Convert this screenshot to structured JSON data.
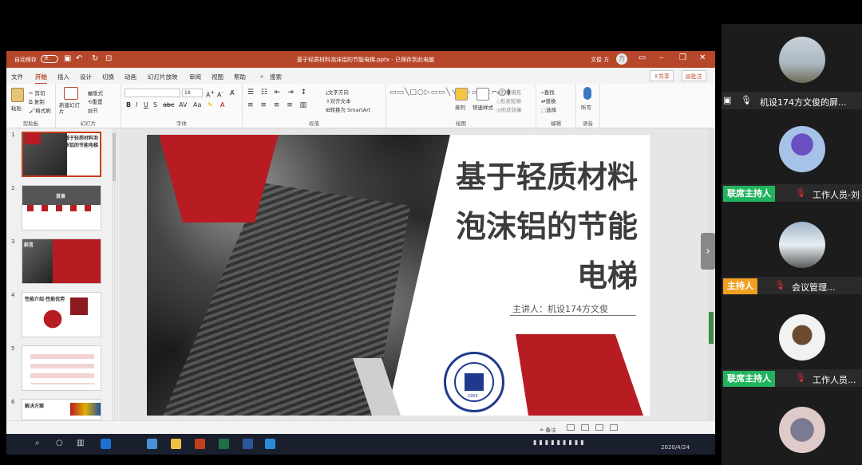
{
  "titlebar": {
    "autosave": "自动保存",
    "autosave_state": "关",
    "doc_title": "基于轻质材料泡沫铝的节能电梯.pptx - 已保存到此电脑",
    "user": "文俊 方",
    "user_initial": "方"
  },
  "tabs": [
    "文件",
    "开始",
    "插入",
    "设计",
    "切换",
    "动画",
    "幻灯片放映",
    "审阅",
    "视图",
    "帮助"
  ],
  "search_label": "搜索",
  "share_label": "共享",
  "comment_label": "批注",
  "ribbon": {
    "clipboard": {
      "label": "剪贴板",
      "paste": "粘贴",
      "cut": "剪切",
      "copy": "复制",
      "format_painter": "格式刷"
    },
    "slides": {
      "label": "幻灯片",
      "new_slide": "新建幻灯片",
      "layout": "版式",
      "reset": "重置",
      "section": "节"
    },
    "font": {
      "label": "字体",
      "size": "18"
    },
    "paragraph": {
      "label": "段落",
      "text_direction": "文字方向",
      "align_text": "对齐文本",
      "smartart": "转换为 SmartArt"
    },
    "drawing": {
      "label": "绘图",
      "arrange": "排列",
      "quick_styles": "快速样式",
      "shape_fill": "形状填充",
      "shape_outline": "形状轮廓",
      "shape_effects": "形状效果"
    },
    "editing": {
      "label": "编辑",
      "find": "查找",
      "replace": "替换",
      "select": "选择"
    },
    "voice": {
      "label": "语音",
      "dictate": "听写"
    }
  },
  "thumbnails": [
    {
      "num": "1",
      "title": "基于轻质材料泡沫铝的节能电梯"
    },
    {
      "num": "2",
      "title": "目录"
    },
    {
      "num": "3",
      "title": "前言"
    },
    {
      "num": "4",
      "title": "性能介绍·性能优势"
    },
    {
      "num": "5",
      "title": ""
    },
    {
      "num": "6",
      "title": "解决方案"
    }
  ],
  "slide": {
    "title_line1": "基于轻质材料",
    "title_line2": "泡沫铝的节能",
    "title_line3": "电梯",
    "presenter": "主讲人：机设174方文俊",
    "seal_year": "1903"
  },
  "status": {
    "notes": "备注"
  },
  "taskbar": {
    "date": "2020/4/24"
  },
  "participants": [
    {
      "role": "",
      "name": "机设174方文俊的屏..."
    },
    {
      "role": "联席主持人",
      "name": "工作人员-刘"
    },
    {
      "role": "主持人",
      "name": "会议管理..."
    },
    {
      "role": "联席主持人",
      "name": "工作人员..."
    },
    {
      "role": "",
      "name": ""
    }
  ],
  "colors": {
    "ppt_red": "#b7472a",
    "slide_red": "#b71c22",
    "cohost_green": "#22b35e",
    "host_orange": "#f0a020"
  }
}
